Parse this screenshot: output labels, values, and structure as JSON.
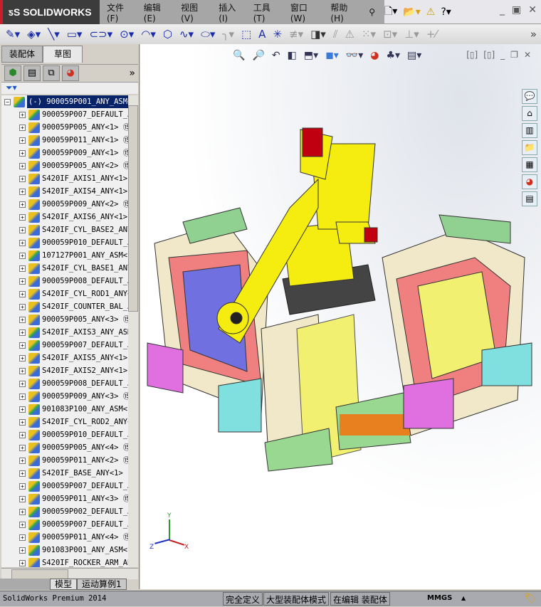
{
  "app": {
    "logo": "SOLIDWORKS"
  },
  "menu": [
    "文件(F)",
    "编辑(E)",
    "视图(V)",
    "插入(I)",
    "工具(T)",
    "窗口(W)",
    "帮助(H)"
  ],
  "left_panel": {
    "tabs": [
      "装配体",
      "草图"
    ],
    "root": "(-) 900059P001_ANY_ASM<",
    "items": [
      {
        "label": "900059P007_DEFAULT_A",
        "asm": true
      },
      {
        "label": "900059P005_ANY<1> ⑮",
        "asm": false
      },
      {
        "label": "900059P011_ANY<1> ⑮",
        "asm": false
      },
      {
        "label": "900059P009_ANY<1> ⑮",
        "asm": false
      },
      {
        "label": "900059P005_ANY<2> ⑮",
        "asm": false
      },
      {
        "label": "S420IF_AXIS1_ANY<1>",
        "asm": false
      },
      {
        "label": "S420IF_AXIS4_ANY<1>",
        "asm": false
      },
      {
        "label": "900059P009_ANY<2> ⑮",
        "asm": false
      },
      {
        "label": "S420IF_AXIS6_ANY<1>",
        "asm": false
      },
      {
        "label": "S420IF_CYL_BASE2_ANY",
        "asm": false
      },
      {
        "label": "900059P010_DEFAULT_A",
        "asm": false
      },
      {
        "label": "107127P001_ANY_ASM<1",
        "asm": true
      },
      {
        "label": "S420IF_CYL_BASE1_ANY",
        "asm": false
      },
      {
        "label": "900059P008_DEFAULT_A",
        "asm": false
      },
      {
        "label": "S420IF_CYL_ROD1_ANY<",
        "asm": false
      },
      {
        "label": "S420IF_COUNTER_BAL_A",
        "asm": false
      },
      {
        "label": "900059P005_ANY<3> ⑮",
        "asm": false
      },
      {
        "label": "S420IF_AXIS3_ANY_ASM",
        "asm": true
      },
      {
        "label": "900059P007_DEFAULT_A",
        "asm": true
      },
      {
        "label": "S420IF_AXIS5_ANY<1>",
        "asm": false
      },
      {
        "label": "S420IF_AXIS2_ANY<1>",
        "asm": false
      },
      {
        "label": "900059P008_DEFAULT_A",
        "asm": false
      },
      {
        "label": "900059P009_ANY<3> ⑮",
        "asm": false
      },
      {
        "label": "901083P100_ANY_ASM<1",
        "asm": true
      },
      {
        "label": "S420IF_CYL_ROD2_ANY<",
        "asm": false
      },
      {
        "label": "900059P010_DEFAULT_A",
        "asm": false
      },
      {
        "label": "900059P005_ANY<4> ⑮",
        "asm": false
      },
      {
        "label": "900059P011_ANY<2> ⑮",
        "asm": false
      },
      {
        "label": "S420IF_BASE_ANY<1>",
        "asm": false
      },
      {
        "label": "900059P007_DEFAULT_A",
        "asm": true
      },
      {
        "label": "900059P011_ANY<3> ⑮",
        "asm": false
      },
      {
        "label": "900059P002_DEFAULT_A",
        "asm": true
      },
      {
        "label": "900059P007_DEFAULT_A",
        "asm": true
      },
      {
        "label": "900059P011_ANY<4> ⑮",
        "asm": false
      },
      {
        "label": "901083P001_ANY_ASM<1",
        "asm": true
      },
      {
        "label": "S420IF_ROCKER_ARM_AN",
        "asm": false
      }
    ],
    "bottom_tabs": [
      "模型",
      "运动算例1"
    ]
  },
  "triad": {
    "x": "X",
    "y": "Y",
    "z": "Z"
  },
  "status": {
    "product": "SolidWorks Premium 2014",
    "state": "完全定义",
    "mode": "大型装配体模式",
    "editing": "在编辑 装配体",
    "units": "MMGS"
  }
}
